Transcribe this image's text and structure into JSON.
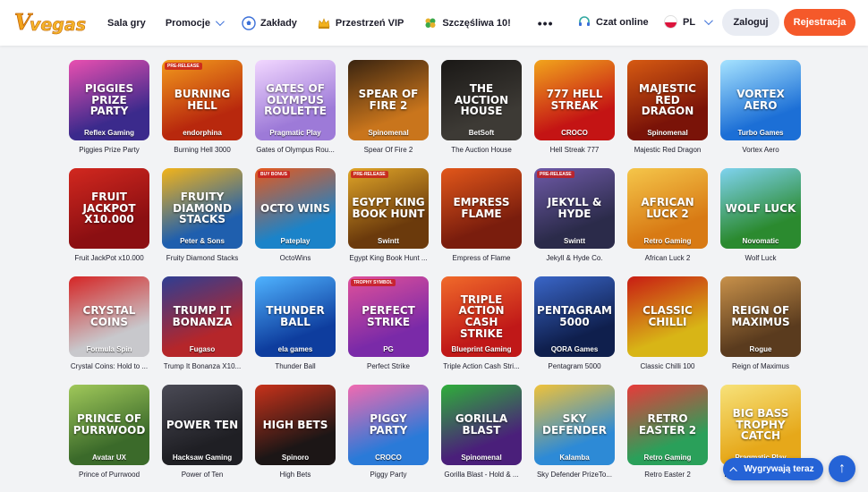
{
  "header": {
    "logo_text": "V.vegas",
    "nav": [
      {
        "label": "Sala gry",
        "icon": "",
        "dropdown": false
      },
      {
        "label": "Promocje",
        "icon": "",
        "dropdown": true
      },
      {
        "label": "Zakłady",
        "icon": "football-icon",
        "dropdown": false
      },
      {
        "label": "Przestrzeń VIP",
        "icon": "crown-icon",
        "dropdown": false
      },
      {
        "label": "Szczęśliwa 10!",
        "icon": "clover-icon",
        "dropdown": false
      }
    ],
    "more_label": "•••",
    "chat_label": "Czat online",
    "language": "PL",
    "login_label": "Zaloguj",
    "register_label": "Rejestracja"
  },
  "games": [
    {
      "name": "Piggies Prize Party",
      "art": "Piggies Prize Party",
      "provider": "Reflex Gaming",
      "badge": "",
      "bg": "#3b2a8c",
      "bg2": "#e94fb0"
    },
    {
      "name": "Burning Hell 3000",
      "art": "Burning Hell",
      "provider": "endorphina",
      "badge": "Pre-release",
      "bg": "#b8280d",
      "bg2": "#f39a1c"
    },
    {
      "name": "Gates of Olympus Rou...",
      "art": "Gates of Olympus Roulette",
      "provider": "Pragmatic Play",
      "badge": "",
      "bg": "#9d7ad8",
      "bg2": "#f2d7ff"
    },
    {
      "name": "Spear Of Fire 2",
      "art": "Spear of Fire 2",
      "provider": "Spinomenal",
      "badge": "",
      "bg": "#c9751c",
      "bg2": "#3a2410"
    },
    {
      "name": "The Auction House",
      "art": "The Auction House",
      "provider": "BetSoft",
      "badge": "",
      "bg": "#3d3a35",
      "bg2": "#1a1816"
    },
    {
      "name": "Hell Streak 777",
      "art": "777 Hell Streak",
      "provider": "CROCO",
      "badge": "",
      "bg": "#c41414",
      "bg2": "#f2a51c"
    },
    {
      "name": "Majestic Red Dragon",
      "art": "Majestic Red Dragon",
      "provider": "Spinomenal",
      "badge": "",
      "bg": "#7a1308",
      "bg2": "#d65a12"
    },
    {
      "name": "Vortex Aero",
      "art": "Vortex Aero",
      "provider": "Turbo Games",
      "badge": "",
      "bg": "#1c6fd6",
      "bg2": "#a6e3ff"
    },
    {
      "name": "Fruit JackPot x10.000",
      "art": "Fruit Jackpot x10.000",
      "provider": "",
      "badge": "",
      "bg": "#8b0f12",
      "bg2": "#d2281f"
    },
    {
      "name": "Fruity Diamond Stacks",
      "art": "Fruity Diamond Stacks",
      "provider": "Peter & Sons",
      "badge": "",
      "bg": "#1f5fae",
      "bg2": "#f3b41a"
    },
    {
      "name": "OctoWins",
      "art": "Octo Wins",
      "provider": "Pateplay",
      "badge": "Buy bonus",
      "bg": "#1b83c9",
      "bg2": "#e8581b"
    },
    {
      "name": "Egypt King Book Hunt ...",
      "art": "Egypt King Book Hunt",
      "provider": "Swintt",
      "badge": "Pre-release",
      "bg": "#6b3a0c",
      "bg2": "#e0a528"
    },
    {
      "name": "Empress of Flame",
      "art": "Empress Flame",
      "provider": "",
      "badge": "",
      "bg": "#7a1d0d",
      "bg2": "#e2571a"
    },
    {
      "name": "Jekyll & Hyde Co.",
      "art": "Jekyll & Hyde",
      "provider": "Swintt",
      "badge": "Pre-release",
      "bg": "#2b2b4a",
      "bg2": "#6f5aa8"
    },
    {
      "name": "African Luck 2",
      "art": "African Luck 2",
      "provider": "Retro Gaming",
      "badge": "",
      "bg": "#d87a14",
      "bg2": "#f5c64a"
    },
    {
      "name": "Wolf Luck",
      "art": "Wolf Luck",
      "provider": "Novomatic",
      "badge": "",
      "bg": "#2b8a2f",
      "bg2": "#7fd3f0"
    },
    {
      "name": "Crystal Coins: Hold to ...",
      "art": "Crystal Coins",
      "provider": "Formula Spin",
      "badge": "",
      "bg": "#c8c8cc",
      "bg2": "#d52525"
    },
    {
      "name": "Trump It Bonanza X10...",
      "art": "Trump It Bonanza",
      "provider": "Fugaso",
      "badge": "",
      "bg": "#b5262a",
      "bg2": "#2e3e93"
    },
    {
      "name": "Thunder Ball",
      "art": "Thunder Ball",
      "provider": "ela games",
      "badge": "",
      "bg": "#0e3d9e",
      "bg2": "#4fb3ff"
    },
    {
      "name": "Perfect Strike",
      "art": "Perfect Strike",
      "provider": "PG",
      "badge": "Trophy symbol",
      "bg": "#7a2aa8",
      "bg2": "#e0509a"
    },
    {
      "name": "Triple Action Cash Stri...",
      "art": "Triple Action Cash Strike",
      "provider": "Blueprint Gaming",
      "badge": "",
      "bg": "#c01818",
      "bg2": "#f06a2a"
    },
    {
      "name": "Pentagram 5000",
      "art": "Pentagram 5000",
      "provider": "QORA Games",
      "badge": "",
      "bg": "#0f1f4d",
      "bg2": "#3a66c8"
    },
    {
      "name": "Classic Chilli 100",
      "art": "Classic Chilli",
      "provider": "",
      "badge": "",
      "bg": "#d8b516",
      "bg2": "#c81c14"
    },
    {
      "name": "Reign of Maximus",
      "art": "Reign of Maximus",
      "provider": "Rogue",
      "badge": "",
      "bg": "#5a3b1e",
      "bg2": "#c8914a"
    },
    {
      "name": "Prince of Purrwood",
      "art": "Prince of Purrwood",
      "provider": "Avatar UX",
      "badge": "",
      "bg": "#3b6a2a",
      "bg2": "#a0c85a"
    },
    {
      "name": "Power of Ten",
      "art": "Power Ten",
      "provider": "Hacksaw Gaming",
      "badge": "",
      "bg": "#1f1f24",
      "bg2": "#4a4a55"
    },
    {
      "name": "High Bets",
      "art": "High Bets",
      "provider": "Spinoro",
      "badge": "",
      "bg": "#1c1616",
      "bg2": "#c8321a"
    },
    {
      "name": "Piggy Party",
      "art": "Piggy Party",
      "provider": "CROCO",
      "badge": "",
      "bg": "#2a7ad8",
      "bg2": "#f26ab0"
    },
    {
      "name": "Gorilla Blast - Hold & ...",
      "art": "Gorilla Blast",
      "provider": "Spinomenal",
      "badge": "",
      "bg": "#4a1f7a",
      "bg2": "#2fae3a"
    },
    {
      "name": "Sky Defender PrizeTo...",
      "art": "Sky Defender",
      "provider": "Kalamba",
      "badge": "",
      "bg": "#2d8ad6",
      "bg2": "#f0c23a"
    },
    {
      "name": "Retro Easter 2",
      "art": "Retro Easter 2",
      "provider": "Retro Gaming",
      "badge": "",
      "bg": "#2aa05a",
      "bg2": "#e83a3a"
    },
    {
      "name": "Big Bass Trophy Catch",
      "art": "Big Bass Trophy Catch",
      "provider": "Pragmatic Play",
      "badge": "",
      "bg": "#e6a81a",
      "bg2": "#f7e27a"
    }
  ],
  "trending_label": "Wygrywają teraz",
  "scroll_top_label": "↑",
  "colors": {
    "accent": "#2563d6",
    "register": "#f5592a",
    "login_bg": "#e9ecf3"
  }
}
